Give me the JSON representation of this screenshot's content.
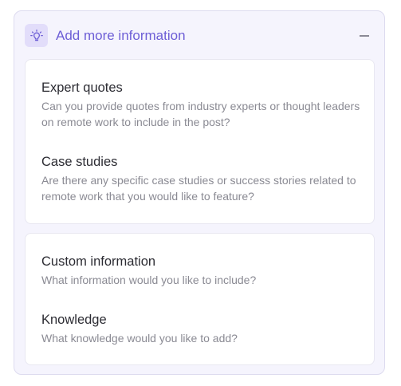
{
  "panel": {
    "title": "Add more information",
    "icon": "lightbulb-icon",
    "accent_color": "#6d5ed6",
    "collapse_icon": "minus-icon"
  },
  "suggestions": [
    {
      "title": "Expert quotes",
      "description": "Can you provide quotes from industry experts or thought leaders on remote work to include in the post?"
    },
    {
      "title": "Case studies",
      "description": "Are there any specific case studies or success stories related to remote work that you would like to feature?"
    }
  ],
  "custom": [
    {
      "title": "Custom information",
      "description": "What information would you like to include?"
    },
    {
      "title": "Knowledge",
      "description": "What knowledge would you like to add?"
    }
  ]
}
